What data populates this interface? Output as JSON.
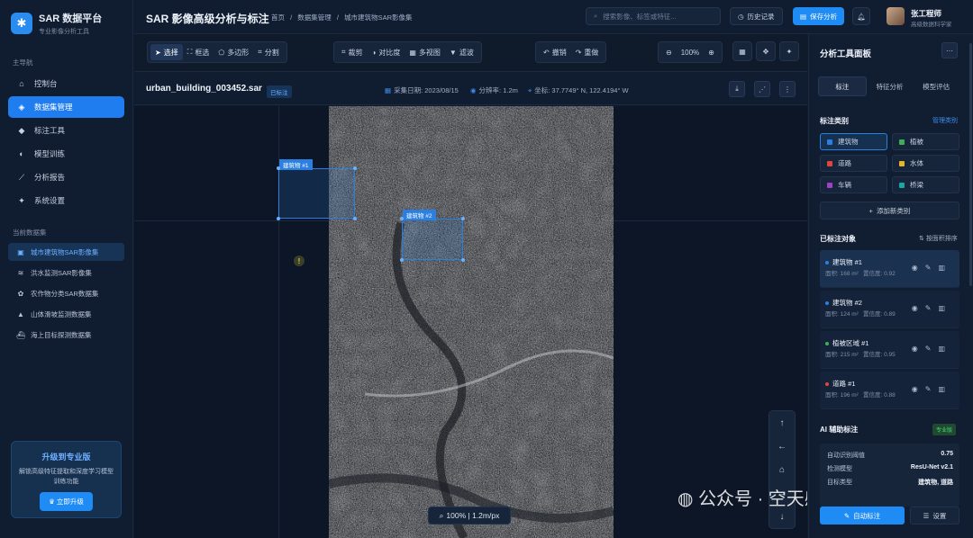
{
  "brand": {
    "title": "SAR 数据平台",
    "subtitle": "专业影像分析工具"
  },
  "nav": {
    "section_title": "主导航",
    "items": [
      {
        "label": "控制台",
        "icon": "home-icon"
      },
      {
        "label": "数据集管理",
        "icon": "layers-icon"
      },
      {
        "label": "标注工具",
        "icon": "tag-icon"
      },
      {
        "label": "模型训练",
        "icon": "brain-icon"
      },
      {
        "label": "分析报告",
        "icon": "chart-line-icon"
      },
      {
        "label": "系统设置",
        "icon": "gear-icon"
      }
    ]
  },
  "datasets": {
    "section_title": "当前数据集",
    "items": [
      {
        "label": "城市建筑物SAR影像集"
      },
      {
        "label": "洪水监测SAR影像集"
      },
      {
        "label": "农作物分类SAR数据集"
      },
      {
        "label": "山体滑坡监测数据集"
      },
      {
        "label": "海上目标探测数据集"
      }
    ]
  },
  "upgrade": {
    "title": "升级到专业版",
    "desc": "解锁高级特征提取和深度学习模型训练功能",
    "button": "立即升级"
  },
  "header": {
    "title": "SAR 影像高级分析与标注",
    "breadcrumb": [
      "首页",
      "/",
      "数据集管理",
      "/",
      "城市建筑物SAR影像集"
    ],
    "search_placeholder": "搜索影像、标签或特征...",
    "history": "历史记录",
    "save": "保存分析",
    "user_name": "张工程师",
    "user_role": "高级数据科学家"
  },
  "toolbar": {
    "select": "选择",
    "box": "框选",
    "polygon": "多边形",
    "segment": "分割",
    "crop": "裁剪",
    "contrast": "对比度",
    "multiview": "多视图",
    "filter": "滤波",
    "undo": "撤销",
    "redo": "重做",
    "zoom": "100%"
  },
  "image": {
    "filename": "urban_building_003452.sar",
    "tag": "已标注",
    "date": "采集日期: 2023/08/15",
    "resolution": "分辨率: 1.2m",
    "coords": "坐标: 37.7749° N, 122.4194° W"
  },
  "canvas": {
    "labels": [
      "建筑物 #1",
      "建筑物 #2"
    ],
    "zoom_status": "100% | 1.2m/px",
    "watermark": "公众号 · 空天感知"
  },
  "panel": {
    "title": "分析工具面板",
    "tabs": [
      "标注",
      "特征分析",
      "模型评估"
    ],
    "categories_title": "标注类别",
    "manage": "管理类别",
    "categories": [
      {
        "label": "建筑物",
        "color": "#2b7fe0"
      },
      {
        "label": "植被",
        "color": "#3fae5a"
      },
      {
        "label": "道路",
        "color": "#e0473c"
      },
      {
        "label": "水体",
        "color": "#e8b52a"
      },
      {
        "label": "车辆",
        "color": "#a23fc7"
      },
      {
        "label": "桥梁",
        "color": "#1aa6a6"
      }
    ],
    "add_category": "添加新类别",
    "objects_title": "已标注对象",
    "sort": "按面积排序",
    "objects": [
      {
        "name": "建筑物 #1",
        "area": "面积: 168 m²",
        "conf": "置信度: 0.92",
        "color": "#2b7fe0"
      },
      {
        "name": "建筑物 #2",
        "area": "面积: 124 m²",
        "conf": "置信度: 0.89",
        "color": "#2b7fe0"
      },
      {
        "name": "植被区域 #1",
        "area": "面积: 215 m²",
        "conf": "置信度: 0.95",
        "color": "#3fae5a"
      },
      {
        "name": "道路 #1",
        "area": "面积: 196 m²",
        "conf": "置信度: 0.88",
        "color": "#e0473c"
      }
    ],
    "ai_title": "AI 辅助标注",
    "ai_badge": "专业版",
    "ai_rows": [
      {
        "k": "自动识别阈值",
        "v": "0.75"
      },
      {
        "k": "检测模型",
        "v": "ResU-Net v2.1"
      },
      {
        "k": "目标类型",
        "v": "建筑物, 道路"
      }
    ],
    "auto_btn": "自动标注",
    "settings_btn": "设置"
  }
}
